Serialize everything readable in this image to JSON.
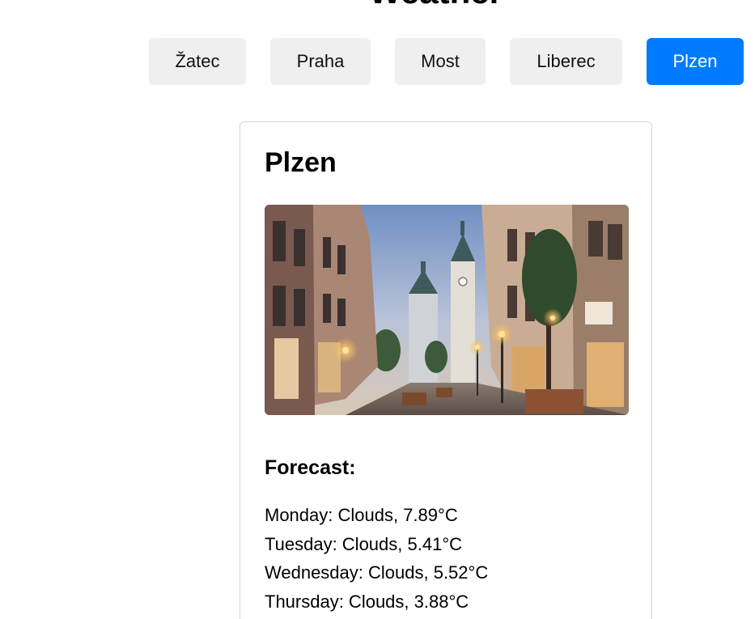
{
  "header": {
    "title": "Weather"
  },
  "city_tabs": [
    {
      "label": "Žatec",
      "active": false
    },
    {
      "label": "Praha",
      "active": false
    },
    {
      "label": "Most",
      "active": false
    },
    {
      "label": "Liberec",
      "active": false
    },
    {
      "label": "Plzen",
      "active": true
    }
  ],
  "card": {
    "city": "Plzen",
    "forecast_heading": "Forecast:",
    "forecast": [
      "Monday: Clouds, 7.89°C",
      "Tuesday: Clouds, 5.41°C",
      "Wednesday: Clouds, 5.52°C",
      "Thursday: Clouds, 3.88°C"
    ]
  },
  "colors": {
    "accent": "#007bff",
    "button_bg": "#efefef",
    "card_border": "#d6d6d6"
  }
}
